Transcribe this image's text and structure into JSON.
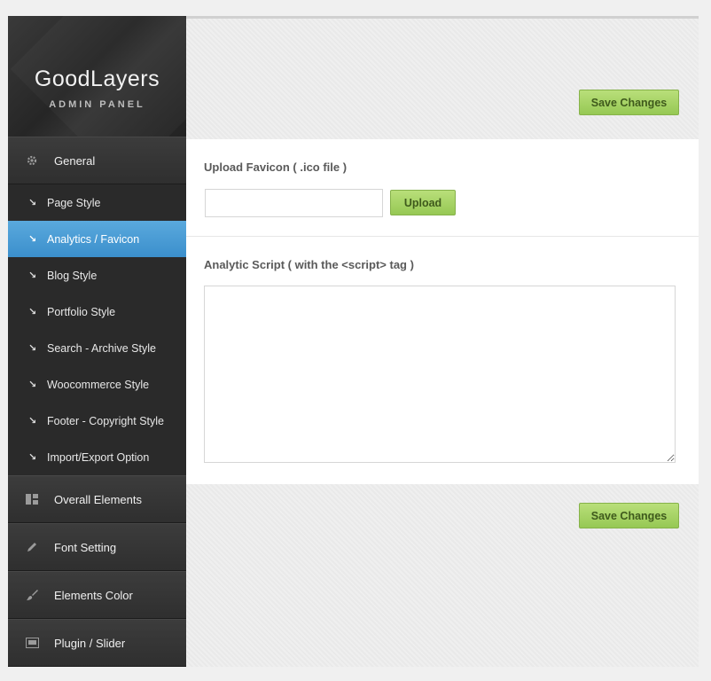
{
  "sidebar": {
    "logo_title": "GoodLayers",
    "logo_subtitle": "ADMIN PANEL",
    "sections": [
      {
        "label": "General",
        "icon": "gear-icon"
      },
      {
        "label": "Overall Elements",
        "icon": "layout-icon"
      },
      {
        "label": "Font Setting",
        "icon": "pencil-icon"
      },
      {
        "label": "Elements Color",
        "icon": "brush-icon"
      },
      {
        "label": "Plugin / Slider",
        "icon": "slider-icon"
      }
    ],
    "general_items": [
      {
        "label": "Page Style"
      },
      {
        "label": "Analytics / Favicon",
        "active": true
      },
      {
        "label": "Blog Style"
      },
      {
        "label": "Portfolio Style"
      },
      {
        "label": "Search - Archive Style"
      },
      {
        "label": "Woocommerce Style"
      },
      {
        "label": "Footer - Copyright Style"
      },
      {
        "label": "Import/Export Option"
      }
    ]
  },
  "main": {
    "save_top_label": "Save Changes",
    "save_bottom_label": "Save Changes",
    "favicon_label": "Upload Favicon ( .ico file )",
    "favicon_value": "",
    "upload_label": "Upload",
    "script_label": "Analytic Script ( with the <script> tag )",
    "script_value": ""
  },
  "colors": {
    "accent_blue": "#4a9fd8",
    "button_green": "#a6d264",
    "sidebar_dark": "#2b2b2b"
  }
}
